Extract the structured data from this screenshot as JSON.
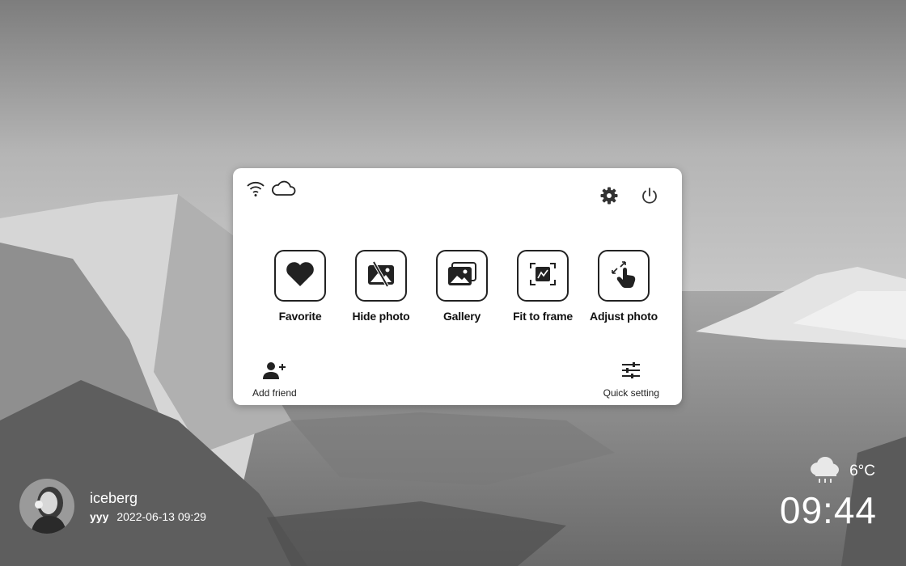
{
  "panel": {
    "status_icons": [
      "wifi-icon",
      "cloud-icon"
    ],
    "top_actions": [
      "settings-gear-icon",
      "power-icon"
    ],
    "tiles": [
      {
        "label": "Favorite",
        "icon": "heart-icon"
      },
      {
        "label": "Hide photo",
        "icon": "hide-photo-icon"
      },
      {
        "label": "Gallery",
        "icon": "gallery-icon"
      },
      {
        "label": "Fit to frame",
        "icon": "fit-frame-icon"
      },
      {
        "label": "Adjust photo",
        "icon": "adjust-hand-icon"
      }
    ],
    "add_friend_label": "Add friend",
    "quick_setting_label": "Quick setting"
  },
  "photo_info": {
    "caption": "iceberg",
    "sender": "yyy",
    "timestamp": "2022-06-13 09:29"
  },
  "weather": {
    "icon": "cloud-rain-icon",
    "temperature": "6°C"
  },
  "clock": {
    "time": "09:44"
  }
}
